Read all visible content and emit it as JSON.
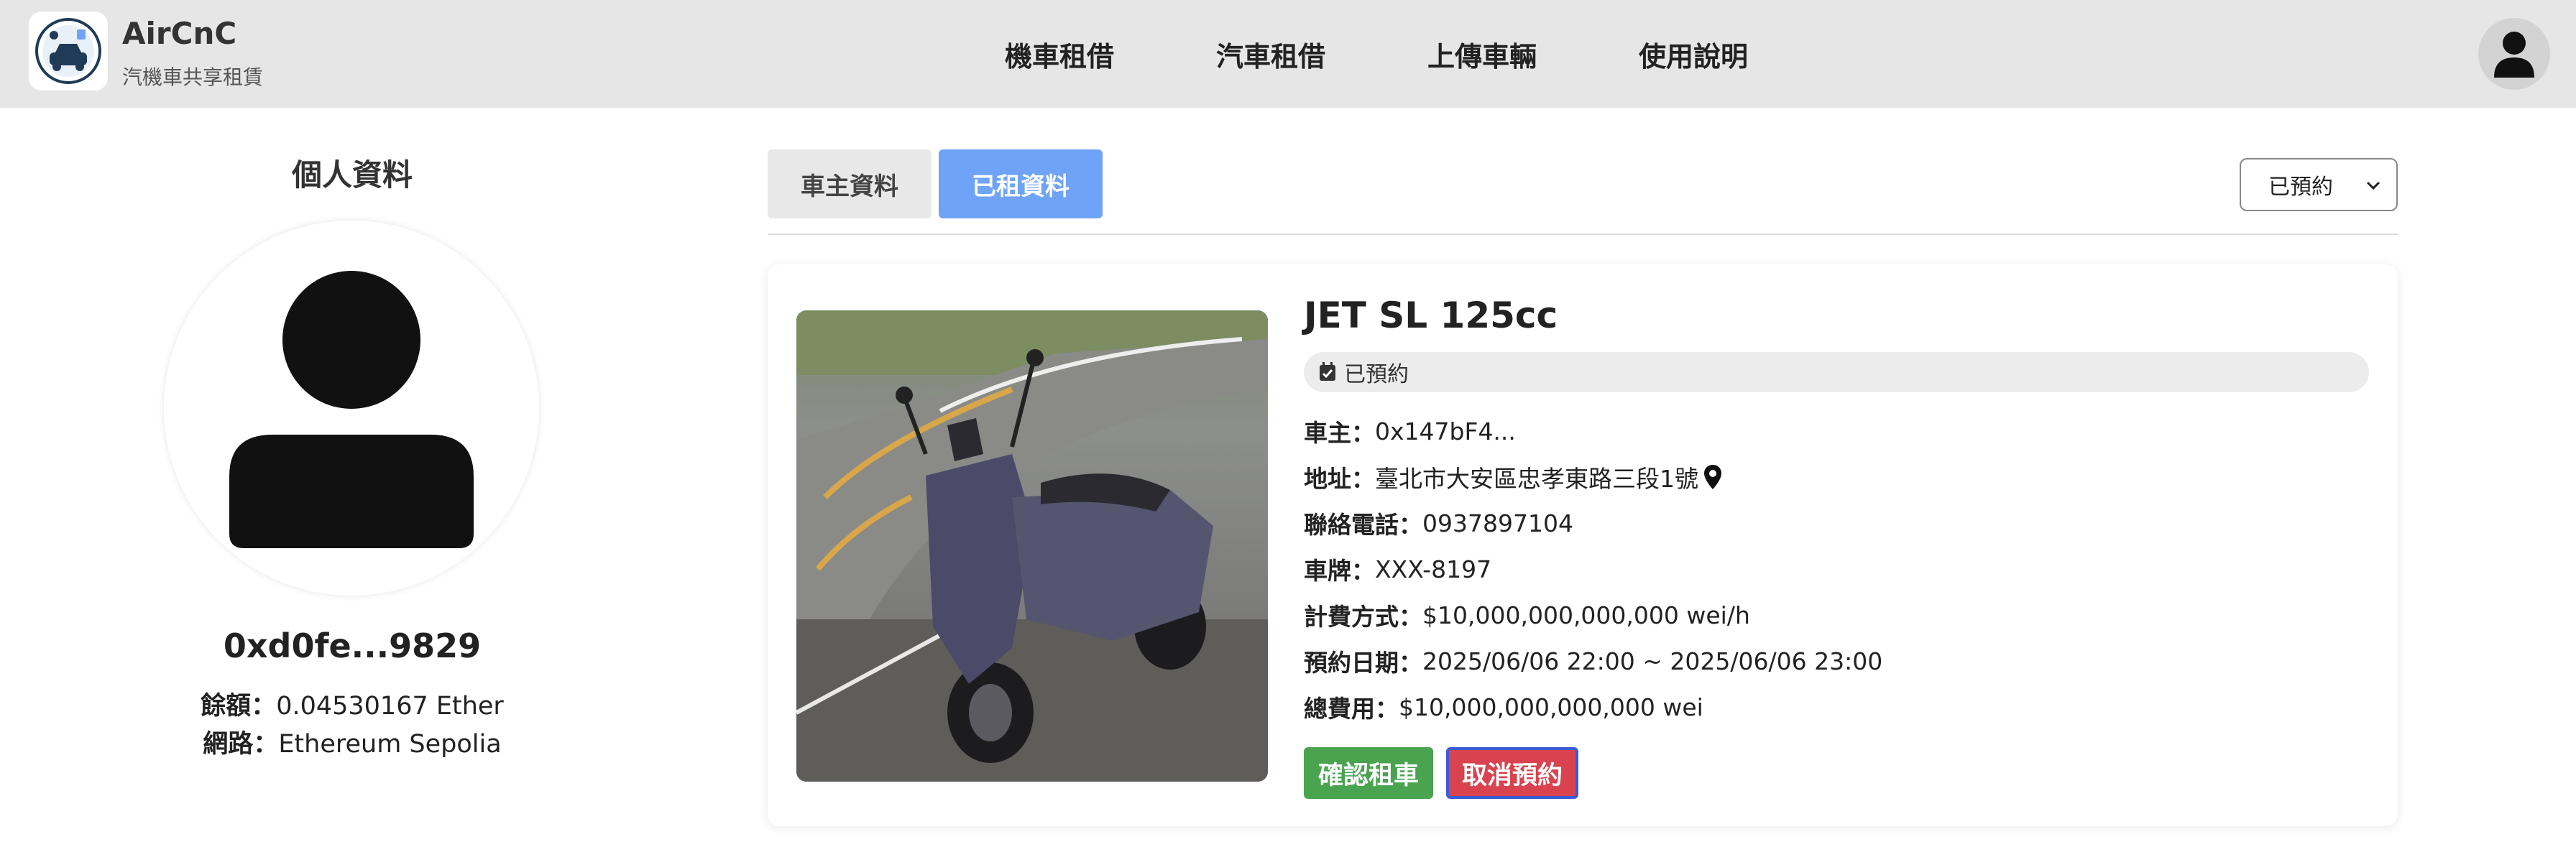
{
  "header": {
    "brand_title": "AirCnC",
    "brand_subtitle": "汽機車共享租賃",
    "nav": [
      "機車租借",
      "汽車租借",
      "上傳車輛",
      "使用說明"
    ]
  },
  "profile": {
    "heading": "個人資料",
    "address_short": "0xd0fe...9829",
    "balance_label": "餘額",
    "balance_value": "0.04530167 Ether",
    "network_label": "網路",
    "network_value": "Ethereum Sepolia"
  },
  "tabs": {
    "owner": "車主資料",
    "rented": "已租資料"
  },
  "filter": {
    "selected": "已預約"
  },
  "rental": {
    "title": "JET SL 125cc",
    "status": "已預約",
    "owner_label": "車主",
    "owner_value": "0x147bF4...",
    "address_label": "地址",
    "address_value": "臺北市大安區忠孝東路三段1號",
    "phone_label": "聯絡電話",
    "phone_value": "0937897104",
    "plate_label": "車牌",
    "plate_value": "XXX-8197",
    "rate_label": "計費方式",
    "rate_value": "$10,000,000,000,000 wei/h",
    "date_label": "預約日期",
    "date_value": "2025/06/06 22:00 ~ 2025/06/06 23:00",
    "total_label": "總費用",
    "total_value": "$10,000,000,000,000 wei",
    "confirm_label": "確認租車",
    "cancel_label": "取消預約"
  },
  "colors": {
    "header_bg": "#e6e6e6",
    "tab_active": "#6ea3f7",
    "confirm": "#4aa34f",
    "cancel": "#d8434f"
  },
  "icons": [
    "app-logo-icon",
    "user-icon",
    "avatar-icon",
    "calendar-check-icon",
    "map-pin-icon",
    "chevron-down-icon"
  ]
}
